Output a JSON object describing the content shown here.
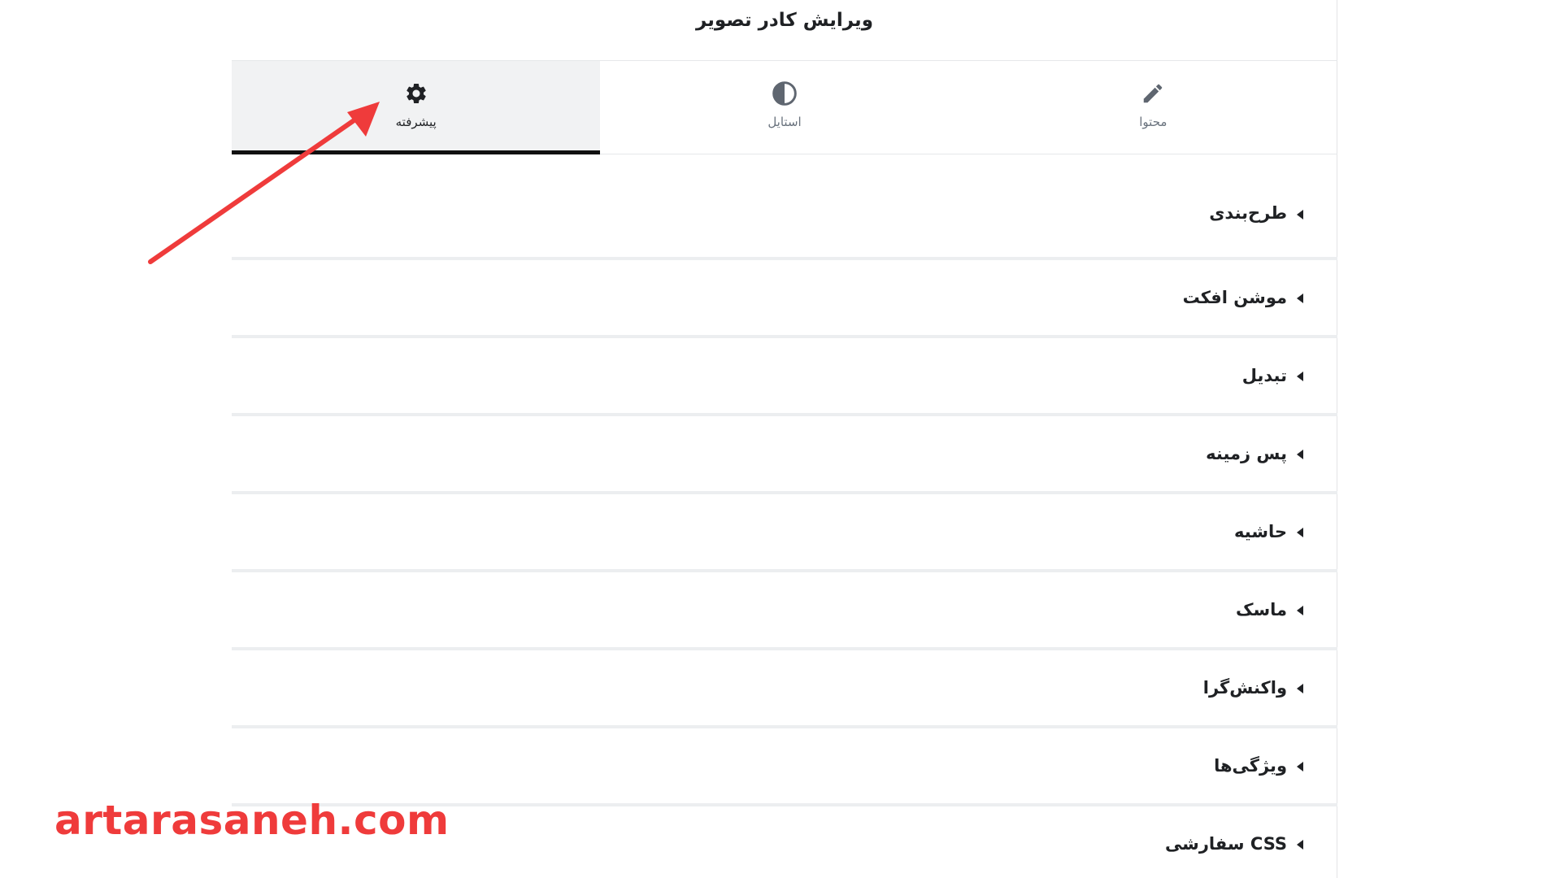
{
  "panel": {
    "title": "ویرایش کادر تصویر"
  },
  "tabs": [
    {
      "label": "محتوا",
      "icon": "pencil-icon",
      "active": false
    },
    {
      "label": "استایل",
      "icon": "contrast-icon",
      "active": false
    },
    {
      "label": "پیشرفته",
      "icon": "gear-icon",
      "active": true
    }
  ],
  "sections": [
    {
      "title": "طرح‌بندی"
    },
    {
      "title": "موشن افکت"
    },
    {
      "title": "تبدیل"
    },
    {
      "title": "پس زمینه"
    },
    {
      "title": "حاشیه"
    },
    {
      "title": "ماسک"
    },
    {
      "title": "واکنش‌گرا"
    },
    {
      "title": "ویژگی‌ها"
    },
    {
      "title": "CSS سفارشی"
    }
  ],
  "watermark": "artarasaneh.com",
  "colors": {
    "accent_arrow": "#ef3b3b",
    "active_tab_bg": "#f1f2f3",
    "active_tab_indicator": "#111111",
    "text_dark": "#1f2124",
    "text_muted": "#69727d"
  }
}
